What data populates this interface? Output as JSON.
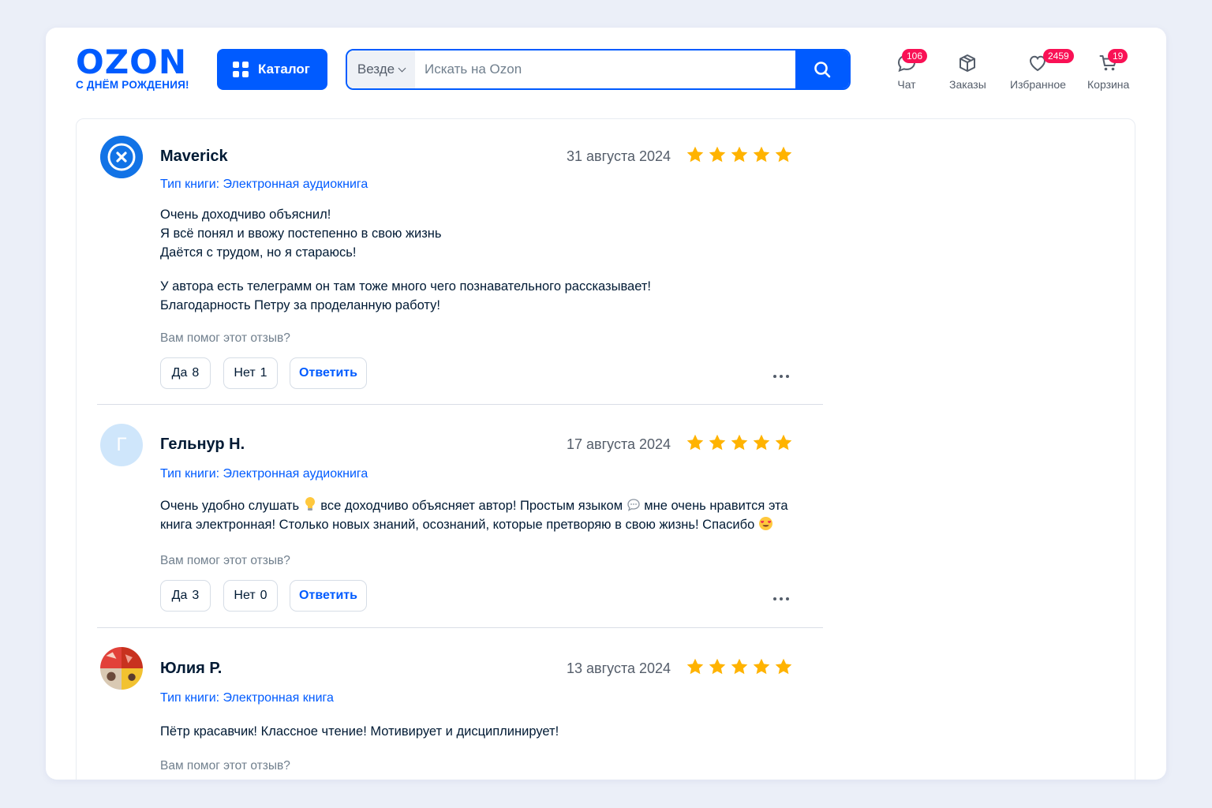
{
  "header": {
    "logo_text": "OZON",
    "logo_subtitle": "С ДНЁМ РОЖДЕНИЯ!",
    "catalog_label": "Каталог",
    "search": {
      "scope": "Везде",
      "placeholder": "Искать на Ozon"
    },
    "nav": {
      "chat": {
        "label": "Чат",
        "badge": "106"
      },
      "orders": {
        "label": "Заказы"
      },
      "favorites": {
        "label": "Избранное",
        "badge": "2459"
      },
      "cart": {
        "label": "Корзина",
        "badge": "19"
      }
    }
  },
  "colors": {
    "brand": "#005bff",
    "badge": "#f91155",
    "star": "#ffb300"
  },
  "reviews": [
    {
      "author": "Maverick",
      "date": "31 августа 2024",
      "rating": 5,
      "book_type": "Тип книги: Электронная аудиокнига",
      "lines": [
        "Очень доходчиво объяснил!",
        "Я всё понял и ввожу постепенно в свою жизнь",
        "Даётся с трудом, но я стараюсь!",
        "У автора есть телеграмм он там тоже много чего познавательного рассказывает!",
        "Благодарность Петру за проделанную работу!"
      ],
      "helpful_question": "Вам помог этот отзыв?",
      "yes": {
        "label": "Да",
        "count": "8"
      },
      "no": {
        "label": "Нет",
        "count": "1"
      },
      "reply_label": "Ответить"
    },
    {
      "author": "Гельнур Н.",
      "avatar_letter": "Г",
      "date": "17 августа 2024",
      "rating": 5,
      "book_type": "Тип книги: Электронная аудиокнига",
      "parts": [
        "Очень удобно слушать",
        "все доходчиво объясняет автор! Простым языком",
        "мне очень нравится эта книга",
        "электронная! Столько новых знаний, осознаний, которые претворяю в свою жизнь! Спасибо"
      ],
      "helpful_question": "Вам помог этот отзыв?",
      "yes": {
        "label": "Да",
        "count": "3"
      },
      "no": {
        "label": "Нет",
        "count": "0"
      },
      "reply_label": "Ответить"
    },
    {
      "author": "Юлия Р.",
      "date": "13 августа 2024",
      "rating": 5,
      "book_type": "Тип книги: Электронная книга",
      "lines": [
        "Пётр красавчик! Классное чтение! Мотивирует и дисциплинирует!"
      ],
      "helpful_question": "Вам помог этот отзыв?"
    }
  ]
}
